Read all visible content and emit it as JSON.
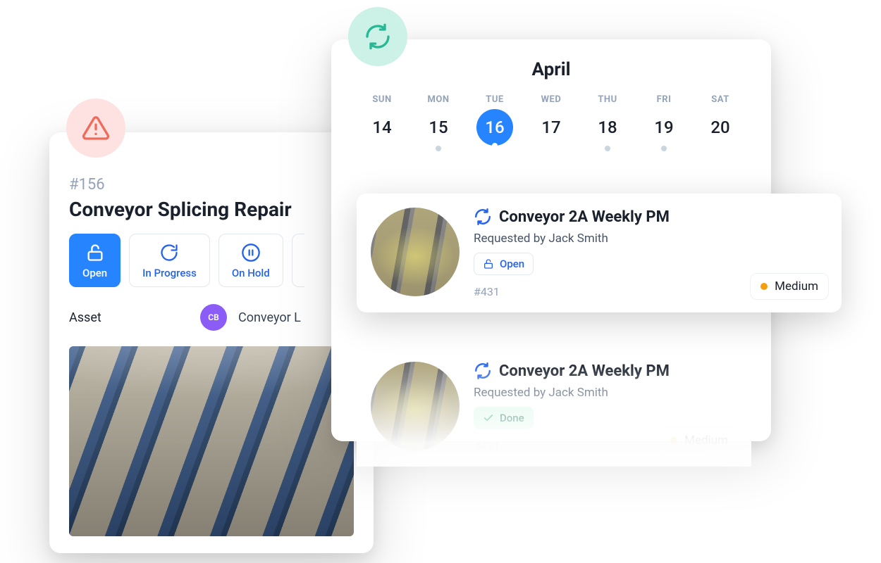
{
  "work_order": {
    "id": "#156",
    "title": "Conveyor Splicing Repair",
    "status_options": [
      {
        "key": "open",
        "label": "Open",
        "active": true
      },
      {
        "key": "in_progress",
        "label": "In Progress",
        "active": false
      },
      {
        "key": "on_hold",
        "label": "On Hold",
        "active": false
      }
    ],
    "asset_field_label": "Asset",
    "asset_avatar_initials": "CB",
    "asset_name": "Conveyor L"
  },
  "calendar": {
    "month": "April",
    "dow": [
      "SUN",
      "MON",
      "TUE",
      "WED",
      "THU",
      "FRI",
      "SAT"
    ],
    "days": [
      {
        "num": "14",
        "dot": false,
        "selected": false
      },
      {
        "num": "15",
        "dot": true,
        "selected": false
      },
      {
        "num": "16",
        "dot": true,
        "selected": true
      },
      {
        "num": "17",
        "dot": false,
        "selected": false
      },
      {
        "num": "18",
        "dot": true,
        "selected": false
      },
      {
        "num": "19",
        "dot": true,
        "selected": false
      },
      {
        "num": "20",
        "dot": false,
        "selected": false
      }
    ]
  },
  "tasks": [
    {
      "title": "Conveyor 2A Weekly PM",
      "requested_by": "Requested by Jack Smith",
      "status_label": "Open",
      "status_kind": "open",
      "id": "#431",
      "priority": "Medium"
    },
    {
      "title": "Conveyor 2A Weekly PM",
      "requested_by": "Requested by Jack Smith",
      "status_label": "Done",
      "status_kind": "done",
      "id": "#431",
      "priority": "Medium"
    }
  ]
}
